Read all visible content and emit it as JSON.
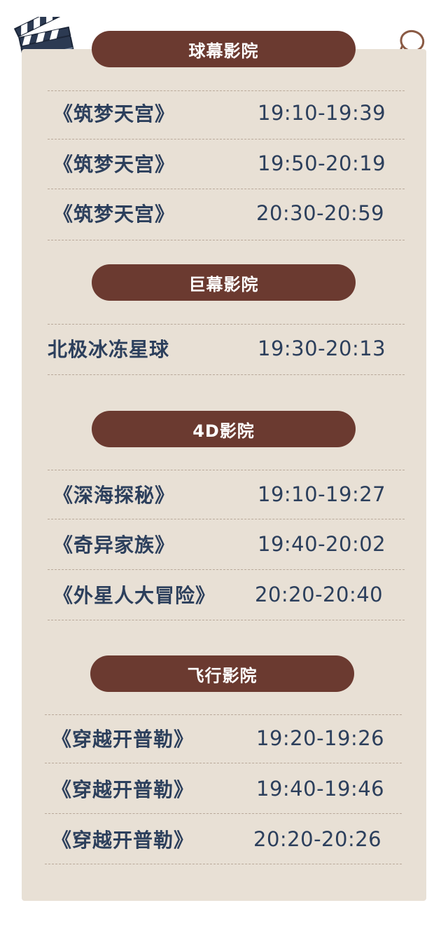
{
  "sections": [
    {
      "heading": "球幕影院",
      "rows": [
        {
          "title": "《筑梦天宫》",
          "time": "19:10-19:39"
        },
        {
          "title": "《筑梦天宫》",
          "time": "19:50-20:19"
        },
        {
          "title": "《筑梦天宫》",
          "time": "20:30-20:59"
        }
      ]
    },
    {
      "heading": "巨幕影院",
      "rows": [
        {
          "title": "北极冰冻星球",
          "time": "19:30-20:13"
        }
      ]
    },
    {
      "heading": "4D影院",
      "rows": [
        {
          "title": "《深海探秘》",
          "time": "19:10-19:27"
        },
        {
          "title": "《奇异家族》",
          "time": "19:40-20:02"
        },
        {
          "title": "《外星人大冒险》",
          "time": "20:20-20:40"
        }
      ]
    },
    {
      "heading": "飞行影院",
      "rows": [
        {
          "title": "《穿越开普勒》",
          "time": "19:20-19:26"
        },
        {
          "title": "《穿越开普勒》",
          "time": "19:40-19:46"
        },
        {
          "title": "《穿越开普勒》",
          "time": "20:20-20:26"
        }
      ]
    }
  ],
  "colors": {
    "card_bg": "#e8e0d5",
    "pill_bg": "#6b3a30",
    "pill_text": "#ffffff",
    "row_text": "#2c3f5c",
    "divider": "#b9a99a"
  },
  "icons": [
    "clapperboard-icon",
    "binder-clip-icon"
  ]
}
